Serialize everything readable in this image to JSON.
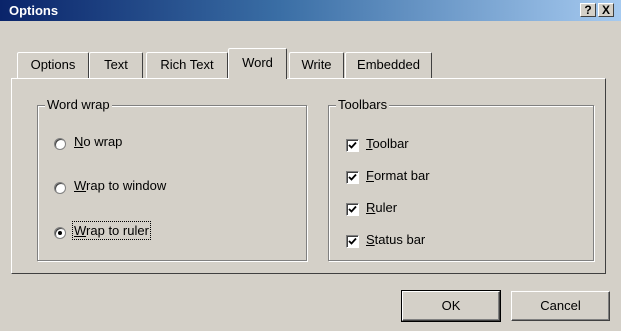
{
  "window": {
    "title": "Options",
    "help_label": "?",
    "close_label": "X"
  },
  "tabs": [
    {
      "label": "Options",
      "active": false
    },
    {
      "label": "Text",
      "active": false
    },
    {
      "label": "Rich Text",
      "active": false
    },
    {
      "label": "Word",
      "active": true
    },
    {
      "label": "Write",
      "active": false
    },
    {
      "label": "Embedded",
      "active": false
    }
  ],
  "word_wrap": {
    "label": "Word wrap",
    "options": [
      {
        "access_key": "N",
        "rest": "o wrap",
        "selected": false
      },
      {
        "access_key": "W",
        "rest": "rap to window",
        "selected": false
      },
      {
        "access_key": "W",
        "rest": "rap to ruler",
        "selected": true
      }
    ]
  },
  "toolbars": {
    "label": "Toolbars",
    "items": [
      {
        "access_key": "T",
        "rest": "oolbar",
        "checked": true
      },
      {
        "access_key": "F",
        "rest": "ormat bar",
        "checked": true
      },
      {
        "access_key": "R",
        "rest": "uler",
        "checked": true
      },
      {
        "access_key": "S",
        "rest": "tatus bar",
        "checked": true
      }
    ]
  },
  "buttons": {
    "ok": "OK",
    "cancel": "Cancel"
  }
}
